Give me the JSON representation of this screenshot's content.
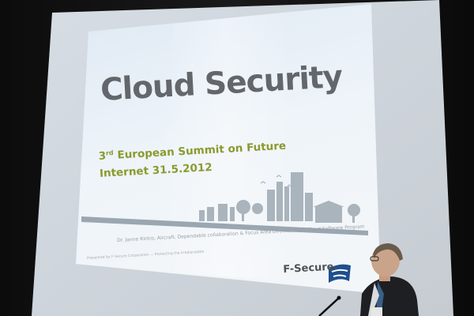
{
  "slide": {
    "title": "Cloud Security",
    "subtitle_ordinal_number": "3",
    "subtitle_ordinal_suffix": "rd",
    "subtitle_line1_rest": " European Summit on Future",
    "subtitle_line2": "Internet 31.5.2012",
    "byline": "Dr. Janne Rintro, Aircraft, Dependable collaboration & Focus Area Director, Tiek, Cloud Software Program",
    "footnote": "Presented by F-Secure Corporation — Protecting the irreplaceable",
    "logo_text": "F-Secure."
  },
  "colors": {
    "title": "#63666b",
    "subtitle": "#8a9a2e",
    "slide_background": "#eaf1f8",
    "skyline": "#a9b4bd",
    "logo_accent": "#1f4f8e"
  }
}
